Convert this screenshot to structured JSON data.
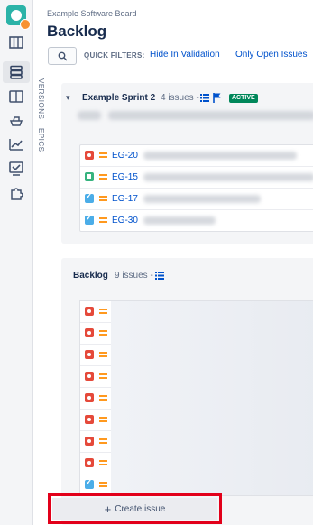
{
  "header": {
    "breadcrumb": "Example Software Board",
    "title": "Backlog"
  },
  "quick_filters": {
    "label": "QUICK FILTERS:",
    "items": [
      "Hide In Validation",
      "Only Open Issues"
    ]
  },
  "side_tabs": [
    "VERSIONS",
    "EPICS"
  ],
  "sprint": {
    "name": "Example Sprint 2",
    "count": "4 issues -",
    "status": "ACTIVE",
    "issues": [
      {
        "type": "bug",
        "key": "EG-20"
      },
      {
        "type": "story",
        "key": "EG-15"
      },
      {
        "type": "task",
        "key": "EG-17"
      },
      {
        "type": "task",
        "key": "EG-30"
      }
    ]
  },
  "backlog": {
    "title": "Backlog",
    "count": "9 issues -",
    "issue_types": [
      "bug",
      "bug",
      "bug",
      "bug",
      "bug",
      "bug",
      "bug",
      "bug",
      "task"
    ]
  },
  "create_issue": {
    "icon": "+",
    "label": "Create issue"
  },
  "colors": {
    "accent": "#0052cc",
    "active": "#00875a",
    "highlight": "#e2001a"
  }
}
